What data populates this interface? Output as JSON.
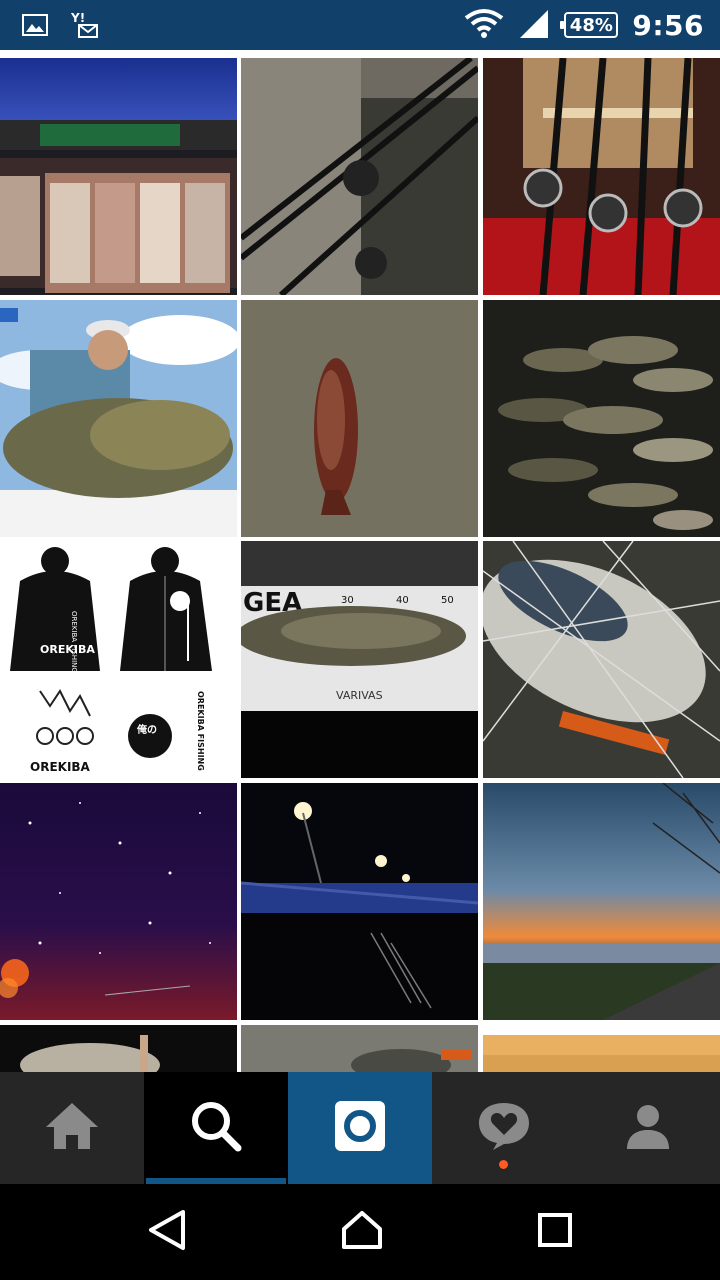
{
  "status_bar": {
    "time": "9:56",
    "battery": "48%",
    "icons": [
      "image-icon",
      "yahoo-mail-icon",
      "wifi-icon",
      "signal-icon",
      "battery-icon"
    ]
  },
  "explore_grid": {
    "tiles": [
      {
        "label": "station-storefront-night"
      },
      {
        "label": "fishing-rods-on-rocks"
      },
      {
        "label": "rods-and-reels-rack"
      },
      {
        "label": "angler-holding-pacu"
      },
      {
        "label": "fish-on-concrete"
      },
      {
        "label": "pile-of-fish-night"
      },
      {
        "label": "orekiba-hoodie-merch",
        "texts": [
          "OREKIBA",
          "OREKIBA FISHING",
          "OREKIBA FISHING",
          "OREKIBA",
          "俺の"
        ]
      },
      {
        "label": "seabass-on-measure",
        "texts": [
          "GEA",
          "30",
          "40",
          "50",
          "VARIVAS"
        ]
      },
      {
        "label": "seabass-in-net-with-lure"
      },
      {
        "label": "starry-night-sky"
      },
      {
        "label": "bridge-at-night"
      },
      {
        "label": "river-sunset"
      },
      {
        "label": "partial-fish-dark"
      },
      {
        "label": "partial-fish-grey"
      },
      {
        "label": "partial-fish-yellow"
      }
    ]
  },
  "bottom_nav": {
    "items": [
      {
        "name": "home-icon"
      },
      {
        "name": "search-icon",
        "active": true
      },
      {
        "name": "camera-icon"
      },
      {
        "name": "activity-heart-icon",
        "notification": true
      },
      {
        "name": "profile-icon"
      }
    ]
  },
  "colors": {
    "status_bar": "#11406b",
    "nav_bar": "#262626",
    "accent": "#125688",
    "notification_dot": "#ff5a1f"
  }
}
